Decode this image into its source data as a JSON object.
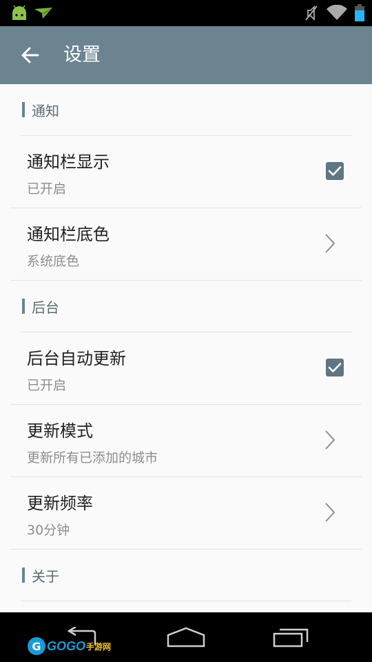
{
  "status_bar": {
    "left_icons": [
      "android-icon",
      "notification-plane-icon"
    ],
    "right_icons": [
      "muted-icon",
      "wifi-icon",
      "battery-icon"
    ]
  },
  "app_bar": {
    "title": "设置",
    "back_icon": "arrow-left-icon",
    "background_color": "#6c8390"
  },
  "sections": [
    {
      "header": "通知",
      "items": [
        {
          "title": "通知栏显示",
          "subtitle": "已开启",
          "control": "checkbox",
          "checked": true
        },
        {
          "title": "通知栏底色",
          "subtitle": "系统底色",
          "control": "chevron"
        }
      ]
    },
    {
      "header": "后台",
      "items": [
        {
          "title": "后台自动更新",
          "subtitle": "已开启",
          "control": "checkbox",
          "checked": true
        },
        {
          "title": "更新模式",
          "subtitle": "更新所有已添加的城市",
          "control": "chevron"
        },
        {
          "title": "更新频率",
          "subtitle": "30分钟",
          "control": "chevron"
        }
      ]
    },
    {
      "header": "关于",
      "items": []
    }
  ],
  "nav_bar": {
    "buttons": [
      "back-icon",
      "home-icon",
      "recents-icon"
    ]
  },
  "watermark": {
    "brand": "GOGO",
    "suffix": "手游网",
    "letter": "G"
  }
}
